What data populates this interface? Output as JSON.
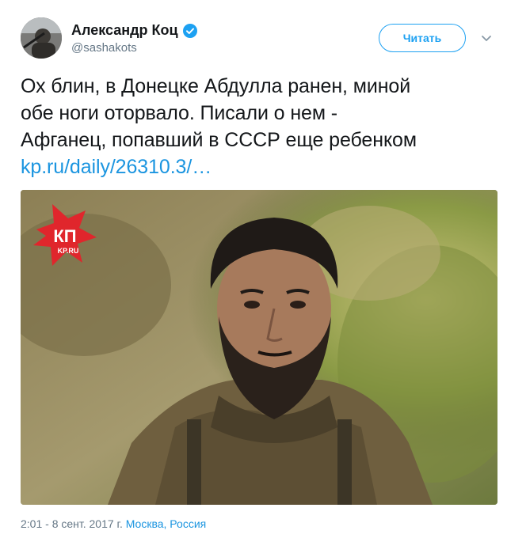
{
  "author": {
    "name": "Александр Коц",
    "handle": "@sashakots",
    "verified": true
  },
  "actions": {
    "follow_label": "Читать"
  },
  "tweet": {
    "lines": [
      "Ох блин, в Донецке Абдулла ранен, миной",
      "обе ноги оторвало. Писали о нем -",
      "Афганец, попавший в СССР еще ребенком"
    ],
    "link": "kp.ru/daily/26310.3/…"
  },
  "media": {
    "watermark_text": "КП",
    "watermark_sub": "KP.RU"
  },
  "footer": {
    "datetime": "2:01 - 8 сент. 2017 г.",
    "location": "Москва, Россия"
  },
  "colors": {
    "accent": "#1da1f2",
    "link": "#1b95e0",
    "muted": "#657786",
    "text": "#14171a"
  },
  "icons": {
    "verified": "verified-badge-icon",
    "menu": "chevron-down-icon"
  }
}
